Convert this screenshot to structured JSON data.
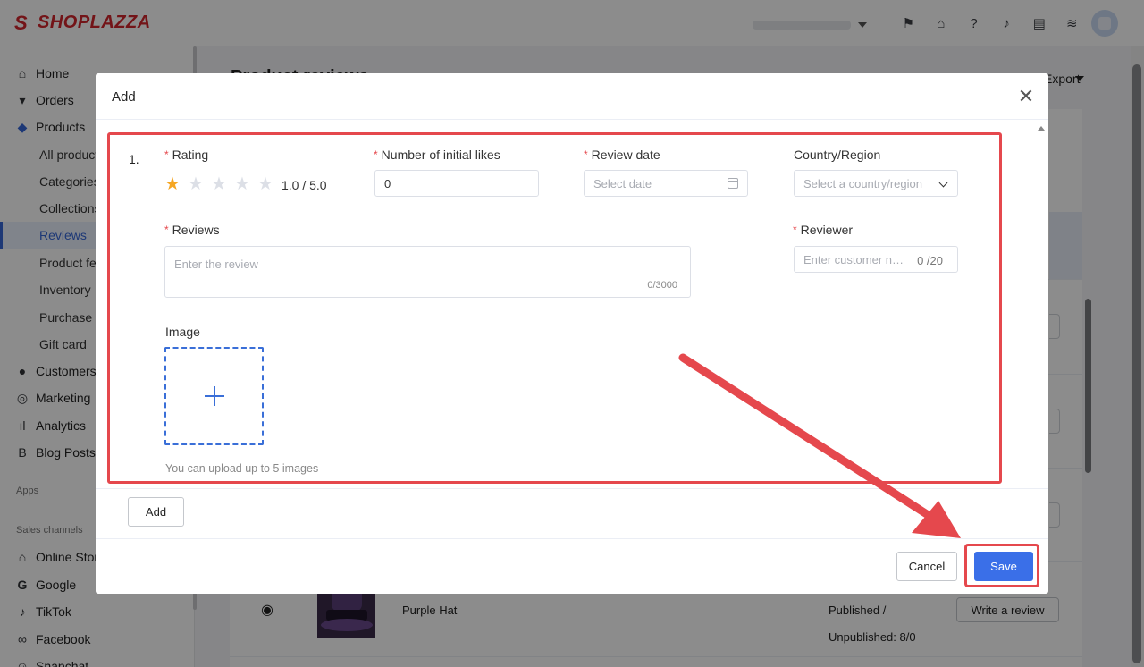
{
  "brand": {
    "name": "SHOPLAZZA"
  },
  "topbar": {
    "icons": [
      "flag-icon",
      "store-icon",
      "help-icon",
      "bell-icon",
      "chat-icon",
      "wifi-icon"
    ]
  },
  "sidebar": {
    "items": [
      {
        "label": "Home",
        "icon": "home-icon"
      },
      {
        "label": "Orders",
        "icon": "orders-icon"
      },
      {
        "label": "Products",
        "icon": "tag-icon"
      }
    ],
    "product_subitems": [
      "All products",
      "Categories",
      "Collections",
      "Reviews",
      "Product feeds",
      "Inventory",
      "Purchase orders",
      "Gift card"
    ],
    "items2": [
      {
        "label": "Customers",
        "icon": "user-icon"
      },
      {
        "label": "Marketing",
        "icon": "marketing-icon"
      },
      {
        "label": "Analytics",
        "icon": "chart-icon"
      },
      {
        "label": "Blog Posts",
        "icon": "blog-icon"
      }
    ],
    "apps_heading": "Apps",
    "sales_heading": "Sales channels",
    "channels": [
      {
        "label": "Online Store",
        "icon": "store-icon"
      },
      {
        "label": "Google",
        "icon": "google-icon"
      },
      {
        "label": "TikTok",
        "icon": "tiktok-icon"
      },
      {
        "label": "Facebook",
        "icon": "facebook-icon"
      },
      {
        "label": "Snapchat",
        "icon": "snapchat-icon"
      }
    ],
    "active": "Reviews"
  },
  "background": {
    "title": "Product reviews",
    "export_label": "Export",
    "row": {
      "product": "Purple Hat",
      "status_line1": "Published /",
      "status_line2": "Unpublished: 8/0",
      "action": "Write a review"
    }
  },
  "modal": {
    "title": "Add",
    "entry_index": "1.",
    "rating": {
      "label": "Rating",
      "value": 1,
      "max": 5,
      "display": "1.0 / 5.0"
    },
    "likes": {
      "label": "Number of initial likes",
      "value": "0"
    },
    "review_date": {
      "label": "Review date",
      "placeholder": "Select date"
    },
    "country": {
      "label": "Country/Region",
      "placeholder": "Select a country/region"
    },
    "reviews": {
      "label": "Reviews",
      "placeholder": "Enter the review",
      "counter": "0/3000"
    },
    "reviewer": {
      "label": "Reviewer",
      "placeholder": "Enter customer name",
      "counter": "0 /20"
    },
    "image": {
      "label": "Image",
      "hint": "You can upload up to 5 images"
    },
    "add_button": "Add",
    "cancel_button": "Cancel",
    "save_button": "Save"
  },
  "colors": {
    "primary": "#3a6fe8",
    "highlight": "#e5484d",
    "star_on": "#f5a623",
    "brand": "#d1262c"
  }
}
